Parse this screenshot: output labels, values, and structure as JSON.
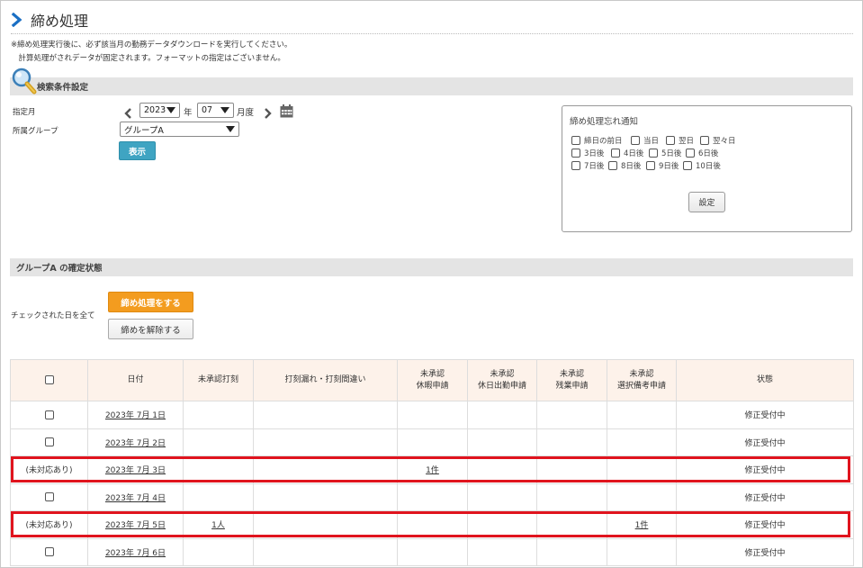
{
  "title": "締め処理",
  "notice": {
    "line1": "※締め処理実行後に、必ず該当月の勤務データダウンロードを実行してください。",
    "line2": "　計算処理がされデータが固定されます。フォーマットの指定はございません。"
  },
  "search": {
    "section_title": "検索条件設定",
    "month_label": "指定月",
    "year_value": "2023",
    "year_unit": "年",
    "month_value": "07",
    "month_unit": "月度",
    "group_label": "所属グループ",
    "group_value": "グループA",
    "show_button": "表示"
  },
  "notify": {
    "title": "締め処理忘れ通知",
    "options": [
      "締日の前日",
      "当日",
      "翌日",
      "翌々日",
      "3日後",
      "4日後",
      "5日後",
      "6日後",
      "7日後",
      "8日後",
      "9日後",
      "10日後"
    ],
    "set_button": "設定"
  },
  "status": {
    "section_title": "グループA の確定状態",
    "check_all_label": "チェックされた日を全て",
    "close_button": "締め処理をする",
    "release_button": "締めを解除する"
  },
  "table": {
    "headers": {
      "date": "日付",
      "unapproved_stamp": "未承認打刻",
      "stamp_errors": "打刻漏れ・打刻間違い",
      "leave": "未承認\n休暇申請",
      "holiday_work": "未承認\n休日出勤申請",
      "overtime": "未承認\n残業申請",
      "note": "未承認\n選択備考申請",
      "state": "状態"
    },
    "rows": [
      {
        "check": "",
        "date": "2023年 7月 1日",
        "unapproved_stamp": "",
        "stamp_errors": "",
        "leave": "",
        "holiday_work": "",
        "overtime": "",
        "note": "",
        "state": "修正受付中"
      },
      {
        "check": "",
        "date": "2023年 7月 2日",
        "unapproved_stamp": "",
        "stamp_errors": "",
        "leave": "",
        "holiday_work": "",
        "overtime": "",
        "note": "",
        "state": "修正受付中"
      },
      {
        "check": "(未対応あり)",
        "date": "2023年 7月 3日",
        "unapproved_stamp": "",
        "stamp_errors": "",
        "leave": "1件",
        "holiday_work": "",
        "overtime": "",
        "note": "",
        "state": "修正受付中"
      },
      {
        "check": "",
        "date": "2023年 7月 4日",
        "unapproved_stamp": "",
        "stamp_errors": "",
        "leave": "",
        "holiday_work": "",
        "overtime": "",
        "note": "",
        "state": "修正受付中"
      },
      {
        "check": "(未対応あり)",
        "date": "2023年 7月 5日",
        "unapproved_stamp": "1人",
        "stamp_errors": "",
        "leave": "",
        "holiday_work": "",
        "overtime": "",
        "note": "1件",
        "state": "修正受付中"
      },
      {
        "check": "",
        "date": "2023年 7月 6日",
        "unapproved_stamp": "",
        "stamp_errors": "",
        "leave": "",
        "holiday_work": "",
        "overtime": "",
        "note": "",
        "state": "修正受付中"
      }
    ]
  },
  "colors": {
    "accent_blue": "#1a6fc4",
    "show_button": "#3fa4c2",
    "close_button": "#f39c1f",
    "header_bg": "#fdf2ea",
    "highlight": "#e0141e"
  }
}
